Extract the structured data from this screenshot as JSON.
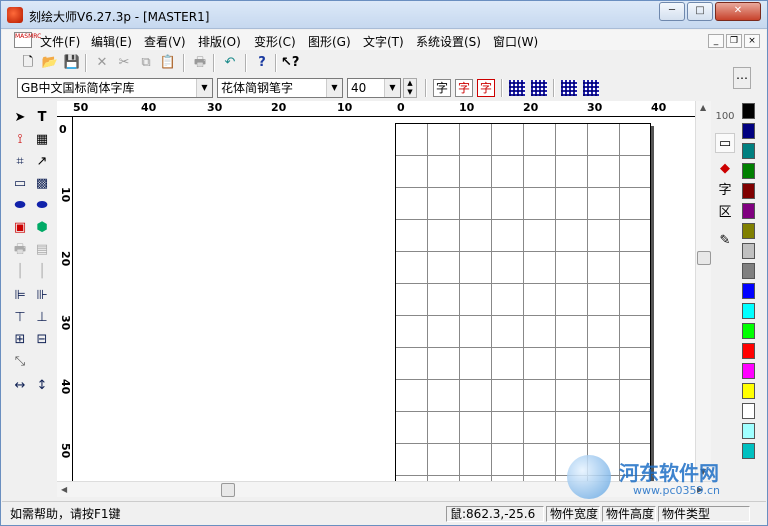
{
  "window": {
    "title": "刻绘大师V6.27.3p - [MASTER1]"
  },
  "window_buttons": {
    "minimize": "─",
    "maximize": "□",
    "close": "✕"
  },
  "menu": {
    "items": [
      "文件(F)",
      "编辑(E)",
      "查看(V)",
      "排版(O)",
      "变形(C)",
      "图形(G)",
      "文字(T)",
      "系统设置(S)",
      "窗口(W)"
    ],
    "mdi": {
      "minimize": "_",
      "restore": "❐",
      "close": "×"
    }
  },
  "toolbar": {
    "font_set": "GB中文国标简体字库",
    "font_name": "花体简钢笔字",
    "font_size": "40",
    "glyphs": {
      "text1": "字",
      "text2": "字",
      "text3": "字"
    }
  },
  "ruler": {
    "h_labels": [
      "50",
      "40",
      "30",
      "20",
      "10",
      "0",
      "10",
      "20",
      "30",
      "40"
    ],
    "v_labels": [
      "0",
      "10",
      "20",
      "30",
      "40",
      "50"
    ]
  },
  "right_panel": {
    "char_label": "字",
    "region_label": "区"
  },
  "palette": [
    "#000000",
    "#000080",
    "#008080",
    "#008000",
    "#800000",
    "#800080",
    "#808000",
    "#c0c0c0",
    "#808080",
    "#0000ff",
    "#00ffff",
    "#00ff00",
    "#ff0000",
    "#ff00ff",
    "#ffff00",
    "#ffffff",
    "#a0ffff",
    "#00c0c0"
  ],
  "status": {
    "help": "如需帮助，请按F1键",
    "mouse": "鼠:862.3,-25.6",
    "width": "物件宽度",
    "height": "物件高度",
    "type": "物件类型"
  },
  "watermark": {
    "name": "河东软件网",
    "url": "www.pc0359.cn"
  }
}
